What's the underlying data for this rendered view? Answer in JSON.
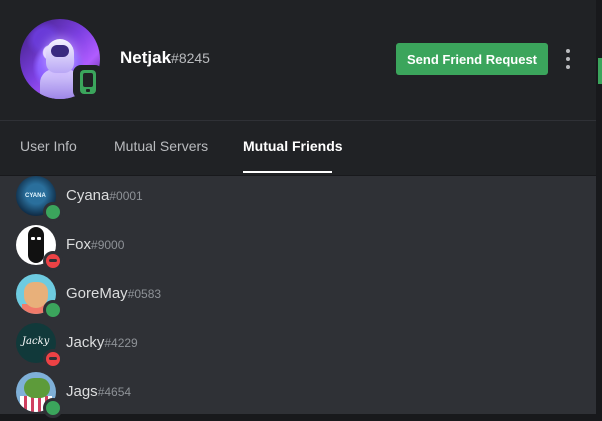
{
  "profile": {
    "username": "Netjak",
    "discriminator": "#8245",
    "status": "mobile-online",
    "avatar_icon": "astronaut-avatar"
  },
  "actions": {
    "send_friend_request": "Send Friend Request",
    "more_icon": "vertical-ellipsis-icon"
  },
  "tabs": [
    {
      "label": "User Info",
      "active": false
    },
    {
      "label": "Mutual Servers",
      "active": false
    },
    {
      "label": "Mutual Friends",
      "active": true
    }
  ],
  "mutual_friends": [
    {
      "name": "Cyana",
      "discriminator": "#0001",
      "status": "online"
    },
    {
      "name": "Fox",
      "discriminator": "#9000",
      "status": "dnd"
    },
    {
      "name": "GoreMay",
      "discriminator": "#0583",
      "status": "online"
    },
    {
      "name": "Jacky",
      "discriminator": "#4229",
      "status": "dnd"
    },
    {
      "name": "Jags",
      "discriminator": "#4654",
      "status": "online"
    }
  ],
  "avatar_labels": {
    "cyana": "CYANA",
    "jacky": "Jacky"
  },
  "colors": {
    "header_bg": "#202225",
    "panel_bg": "#2f3136",
    "online": "#3ba55c",
    "dnd": "#ed4245",
    "button": "#3ba55c"
  }
}
